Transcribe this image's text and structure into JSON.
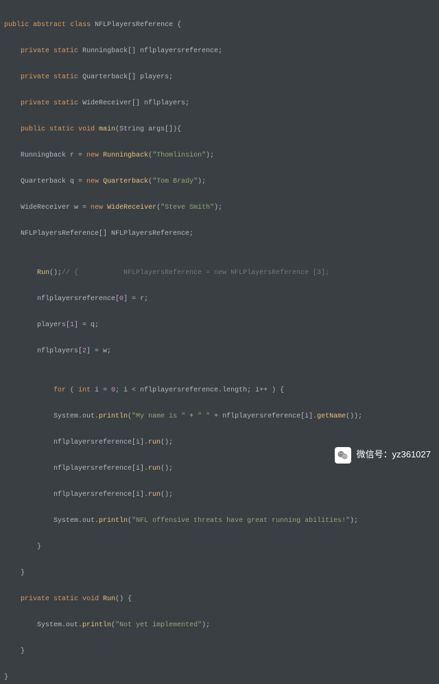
{
  "code": {
    "l1a": "public",
    "l1b": "abstract",
    "l1c": "class",
    "l1d": "NFLPlayersReference {",
    "l2a": "private",
    "l2b": "static",
    "l2c": "Runningback[] nflplayersreference;",
    "l3a": "private",
    "l3b": "static",
    "l3c": "Quarterback[] players;",
    "l4a": "private",
    "l4b": "static",
    "l4c": "WideReceiver[] nflplayers;",
    "l5a": "public",
    "l5b": "static",
    "l5c": "void",
    "l5d": "main",
    "l5e": "(String args[]){",
    "l6a": "Runningback r =",
    "l6b": "new",
    "l6c": "Runningback",
    "l6d": "(",
    "l6e": "\"Thomlinsion\"",
    "l6f": ");",
    "l7a": "Quarterback q =",
    "l7b": "new",
    "l7c": "Quarterback",
    "l7d": "(",
    "l7e": "\"Tom Brady\"",
    "l7f": ");",
    "l8a": "WideReceiver w =",
    "l8b": "new",
    "l8c": "WideReceiver",
    "l8d": "(",
    "l8e": "\"Steve Smith\"",
    "l8f": ");",
    "l9": "NFLPlayersReference[] NFLPlayersReference;",
    "l10a": "Run",
    "l10b": "();",
    "l10c": "// {           NFLPlayersReference = new NFLPlayersReference [3];",
    "l11a": "nflplayersreference[",
    "l11b": "0",
    "l11c": "] = r;",
    "l12a": "players[",
    "l12b": "1",
    "l12c": "] = q;",
    "l13a": "nflplayers[",
    "l13b": "2",
    "l13c": "] = w;",
    "l14a": "for",
    "l14b": " (",
    "l14c": "int",
    "l14d": " i =",
    "l14e": "0",
    "l14f": "; i < nflplayersreference.length; i++ ) {",
    "l15a": "System.out.",
    "l15b": "println",
    "l15c": "(",
    "l15d": "\"My name is \"",
    "l15e": " + ",
    "l15f": "\" \"",
    "l15g": " + nflplayersreference[i].",
    "l15h": "getName",
    "l15i": "());",
    "l16a": "nflplayersreference[i].",
    "l16b": "run",
    "l16c": "();",
    "l17a": "nflplayersreference[i].",
    "l17b": "run",
    "l17c": "();",
    "l18a": "nflplayersreference[i].",
    "l18b": "run",
    "l18c": "();",
    "l19a": "System.out.",
    "l19b": "println",
    "l19c": "(",
    "l19d": "\"NFL offensive threats have great running abilities!\"",
    "l19e": ");",
    "l20": "}",
    "l21": "}",
    "l22a": "private",
    "l22b": "static",
    "l22c": "void",
    "l22d": "Run",
    "l22e": "() {",
    "l23a": "System.out.",
    "l23b": "println",
    "l23c": "(",
    "l23d": "\"Not yet implemented\"",
    "l23e": ");",
    "l24": "}",
    "l25": "}"
  },
  "badge": {
    "label": "微信号：yz361027"
  }
}
